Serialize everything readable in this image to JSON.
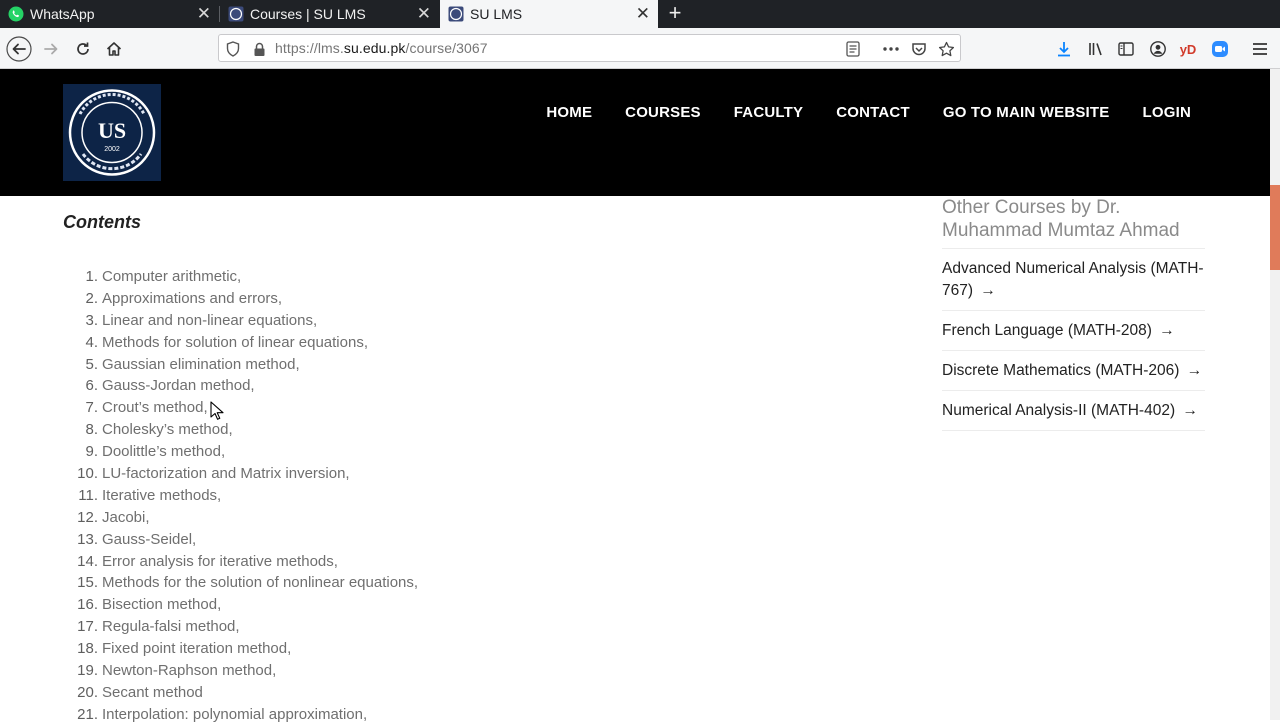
{
  "browser": {
    "tabs": [
      {
        "title": "WhatsApp",
        "active": false
      },
      {
        "title": "Courses | SU LMS",
        "active": false
      },
      {
        "title": "SU LMS",
        "active": true
      }
    ],
    "url": {
      "prefix": "https://lms.",
      "domain": "su.edu.pk",
      "path": "/course/3067"
    },
    "toolbar_extra": "yD"
  },
  "logo": {
    "year": "2002",
    "initials": "US",
    "ring_text": "University of Sargodha"
  },
  "nav": {
    "home": "HOME",
    "courses": "COURSES",
    "faculty": "FACULTY",
    "contact": "CONTACT",
    "main_website": "GO TO MAIN WEBSITE",
    "login": "LOGIN"
  },
  "contents": {
    "title": "Contents",
    "topics": [
      "Computer arithmetic,",
      "Approximations and errors,",
      "Linear and non-linear equations,",
      "Methods for solution of linear equations,",
      "Gaussian elimination method,",
      "Gauss-Jordan method,",
      "Crout’s method,",
      "Cholesky’s method,",
      "Doolittle’s method,",
      "LU-factorization and Matrix inversion,",
      "Iterative methods,",
      "Jacobi,",
      "Gauss-Seidel,",
      "Error analysis for iterative methods,",
      "Methods for the solution of nonlinear equations,",
      "Bisection method,",
      "Regula-falsi method,",
      "Fixed point iteration method,",
      "Newton-Raphson method,",
      "Secant method",
      "Interpolation: polynomial approximation,"
    ]
  },
  "sidebar": {
    "title": "Other Courses by Dr. Muhammad Mumtaz Ahmad",
    "courses": [
      "Advanced Numerical Analysis (MATH-767)",
      "French Language (MATH-208)",
      "Discrete Mathematics (MATH-206)",
      "Numerical Analysis-II (MATH-402)"
    ]
  },
  "colors": {
    "header_bg": "#000000",
    "topic_text": "#6f6f6f",
    "scroll_thumb": "#e07b5a"
  }
}
